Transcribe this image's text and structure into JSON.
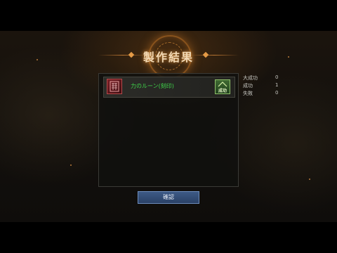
{
  "title": "製作結果",
  "results": [
    {
      "item_name": "力のルーン(刻印)",
      "status": "成功",
      "icon": "rune-icon"
    }
  ],
  "stats": [
    {
      "label": "大成功",
      "value": "0"
    },
    {
      "label": "成功",
      "value": "1"
    },
    {
      "label": "失敗",
      "value": "0"
    }
  ],
  "confirm_label": "確認",
  "colors": {
    "item_name": "#3fd14a",
    "title_glow": "#e49a46",
    "button": "#3d5a86"
  }
}
